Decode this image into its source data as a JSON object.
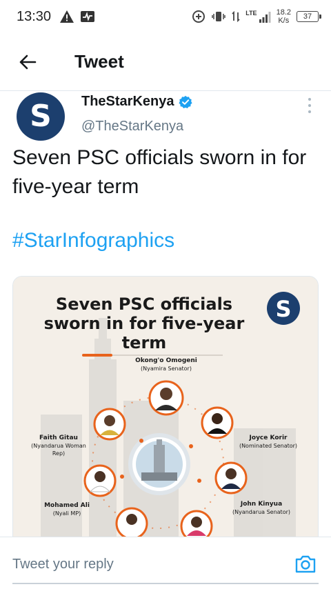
{
  "status_bar": {
    "time": "13:30",
    "lte": "LTE",
    "net_speed_value": "18.2",
    "net_speed_unit": "K/s",
    "battery": "37"
  },
  "app_bar": {
    "title": "Tweet"
  },
  "tweet": {
    "display_name": "TheStarKenya",
    "handle": "@TheStarKenya",
    "avatar_letter": "S",
    "verified": true,
    "text": "Seven PSC officials sworn in for five-year term",
    "hashtag": "#StarInfographics"
  },
  "infographic": {
    "headline_line1": "Seven PSC officials",
    "headline_line2": "sworn in for five-year",
    "headline_line3": "term",
    "people": [
      {
        "name": "Okong'o Omogeni",
        "role": "(Nyamira Senator)"
      },
      {
        "name": "Faith Gitau",
        "role_line1": "(Nyandarua Woman",
        "role_line2": "Rep)"
      },
      {
        "name": "Joyce Korir",
        "role": "(Nominated Senator)"
      },
      {
        "name": "Mohamed Ali",
        "role": "(Nyali MP)"
      },
      {
        "name": "John Kinyua",
        "role": "(Nyandarua Senator)"
      }
    ]
  },
  "reply": {
    "placeholder": "Tweet your reply"
  },
  "colors": {
    "link_blue": "#1da1f2",
    "brand_navy": "#1c3f6e",
    "accent_orange": "#e8631c"
  }
}
